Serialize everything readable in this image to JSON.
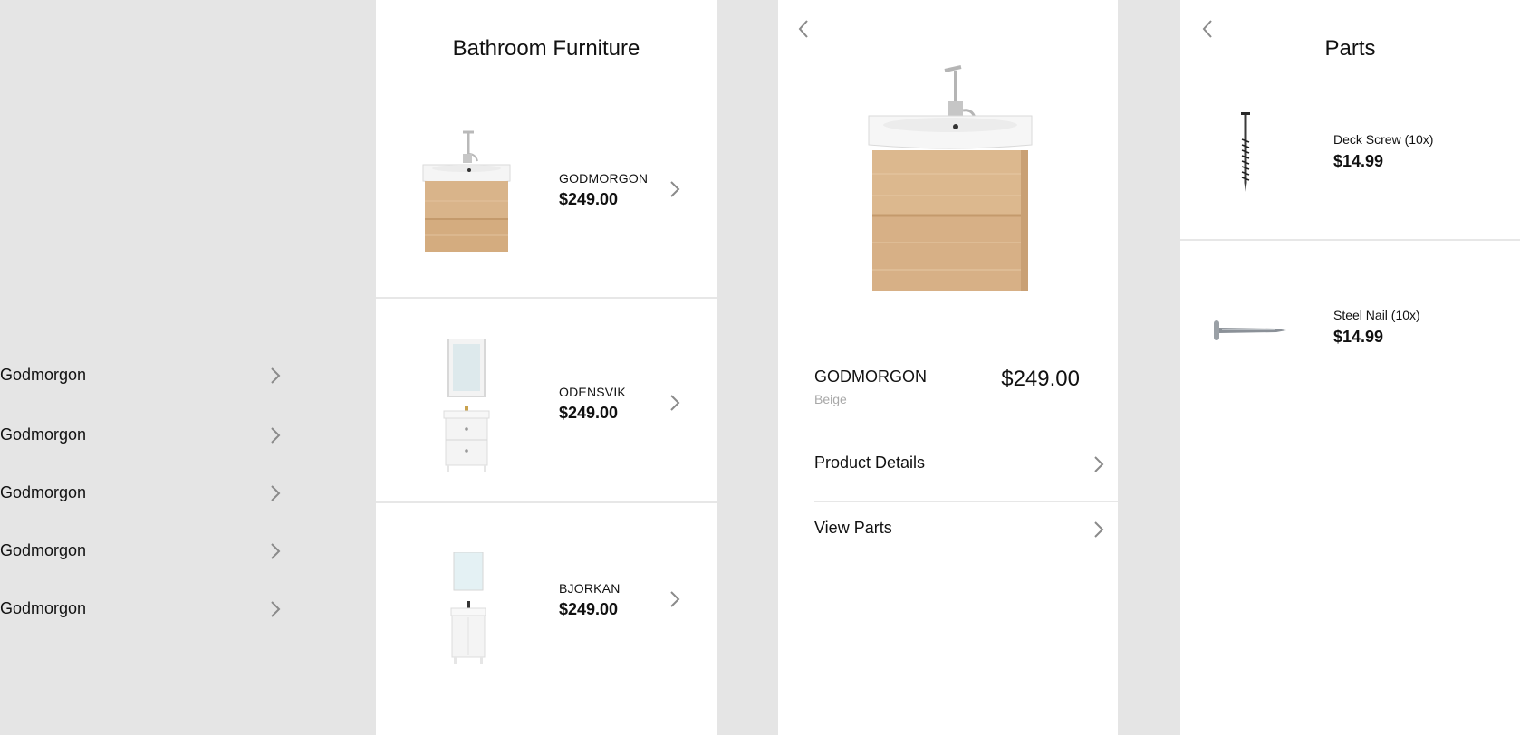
{
  "sidebar": {
    "items": [
      {
        "label": "Godmorgon"
      },
      {
        "label": "Godmorgon"
      },
      {
        "label": "Godmorgon"
      },
      {
        "label": "Godmorgon"
      },
      {
        "label": "Godmorgon"
      }
    ]
  },
  "list_screen": {
    "title": "Bathroom Furniture",
    "products": [
      {
        "name": "GODMORGON",
        "price": "$249.00"
      },
      {
        "name": "ODENSVIK",
        "price": "$249.00"
      },
      {
        "name": "BJORKAN",
        "price": "$249.00"
      }
    ]
  },
  "detail_screen": {
    "name": "GODMORGON",
    "color": "Beige",
    "price": "$249.00",
    "menu": [
      {
        "label": "Product Details"
      },
      {
        "label": "View Parts"
      }
    ]
  },
  "parts_screen": {
    "title": "Parts",
    "parts": [
      {
        "name": "Deck Screw (10x)",
        "price": "$14.99"
      },
      {
        "name": "Steel Nail (10x)",
        "price": "$14.99"
      }
    ]
  },
  "colors": {
    "background": "#e5e5e5",
    "panel": "#ffffff",
    "divider": "#e7e7e7",
    "chevron": "#8a8a8a",
    "wood": "#d9b48a",
    "muted_text": "#a8a8a8"
  },
  "icons": {
    "chevron": "chevron-right-icon",
    "back": "chevron-left-icon"
  }
}
